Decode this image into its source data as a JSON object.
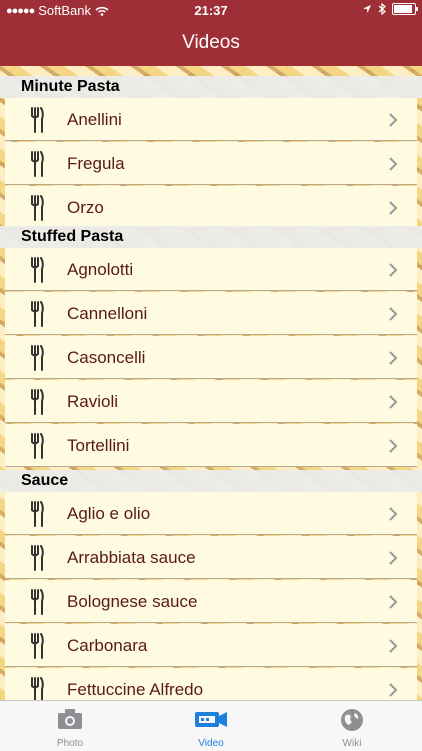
{
  "status_bar": {
    "carrier": "SoftBank",
    "time": "21:37"
  },
  "nav": {
    "title": "Videos"
  },
  "sections": [
    {
      "title": "Minute Pasta",
      "items": [
        "Anellini",
        "Fregula",
        "Orzo"
      ]
    },
    {
      "title": "Stuffed Pasta",
      "items": [
        "Agnolotti",
        "Cannelloni",
        "Casoncelli",
        "Ravioli",
        "Tortellini"
      ]
    },
    {
      "title": "Sauce",
      "items": [
        "Aglio e olio",
        "Arrabbiata sauce",
        "Bolognese sauce",
        "Carbonara",
        "Fettuccine Alfredo"
      ]
    }
  ],
  "tabs": [
    {
      "label": "Photo",
      "icon": "camera-icon"
    },
    {
      "label": "Video",
      "icon": "video-camera-icon",
      "active": true
    },
    {
      "label": "Wiki",
      "icon": "globe-icon"
    }
  ],
  "colors": {
    "bar": "#9f2f36",
    "row_bg": "#fffbe0",
    "row_text": "#5a1a14",
    "active_tab": "#1e7fdc"
  }
}
